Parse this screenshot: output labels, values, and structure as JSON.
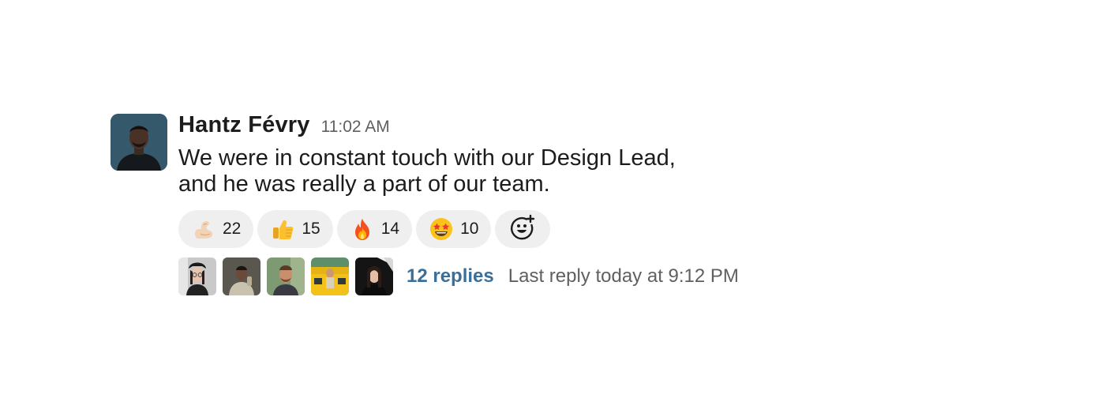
{
  "message": {
    "author": "Hantz Févry",
    "timestamp": "11:02 AM",
    "text_lines": [
      "We were in constant touch with our Design Lead,",
      "and he was really a part of our team."
    ],
    "avatar_icon": "user-avatar"
  },
  "reactions": [
    {
      "emoji": "flexed-biceps-emoji",
      "count": "22"
    },
    {
      "emoji": "thumbs-up-emoji",
      "count": "15"
    },
    {
      "emoji": "fire-emoji",
      "count": "14"
    },
    {
      "emoji": "star-struck-emoji",
      "count": "10"
    }
  ],
  "add_reaction_icon": "add-reaction-icon",
  "thread": {
    "participant_avatars": [
      "user-avatar",
      "user-avatar",
      "user-avatar",
      "user-avatar",
      "user-avatar"
    ],
    "replies_label": "12 replies",
    "last_reply_label": "Last reply today at 9:12 PM"
  },
  "colors": {
    "link": "#3b6f9a",
    "muted_text": "#616061",
    "reaction_bg": "#efefef",
    "text": "#1d1c1d"
  }
}
